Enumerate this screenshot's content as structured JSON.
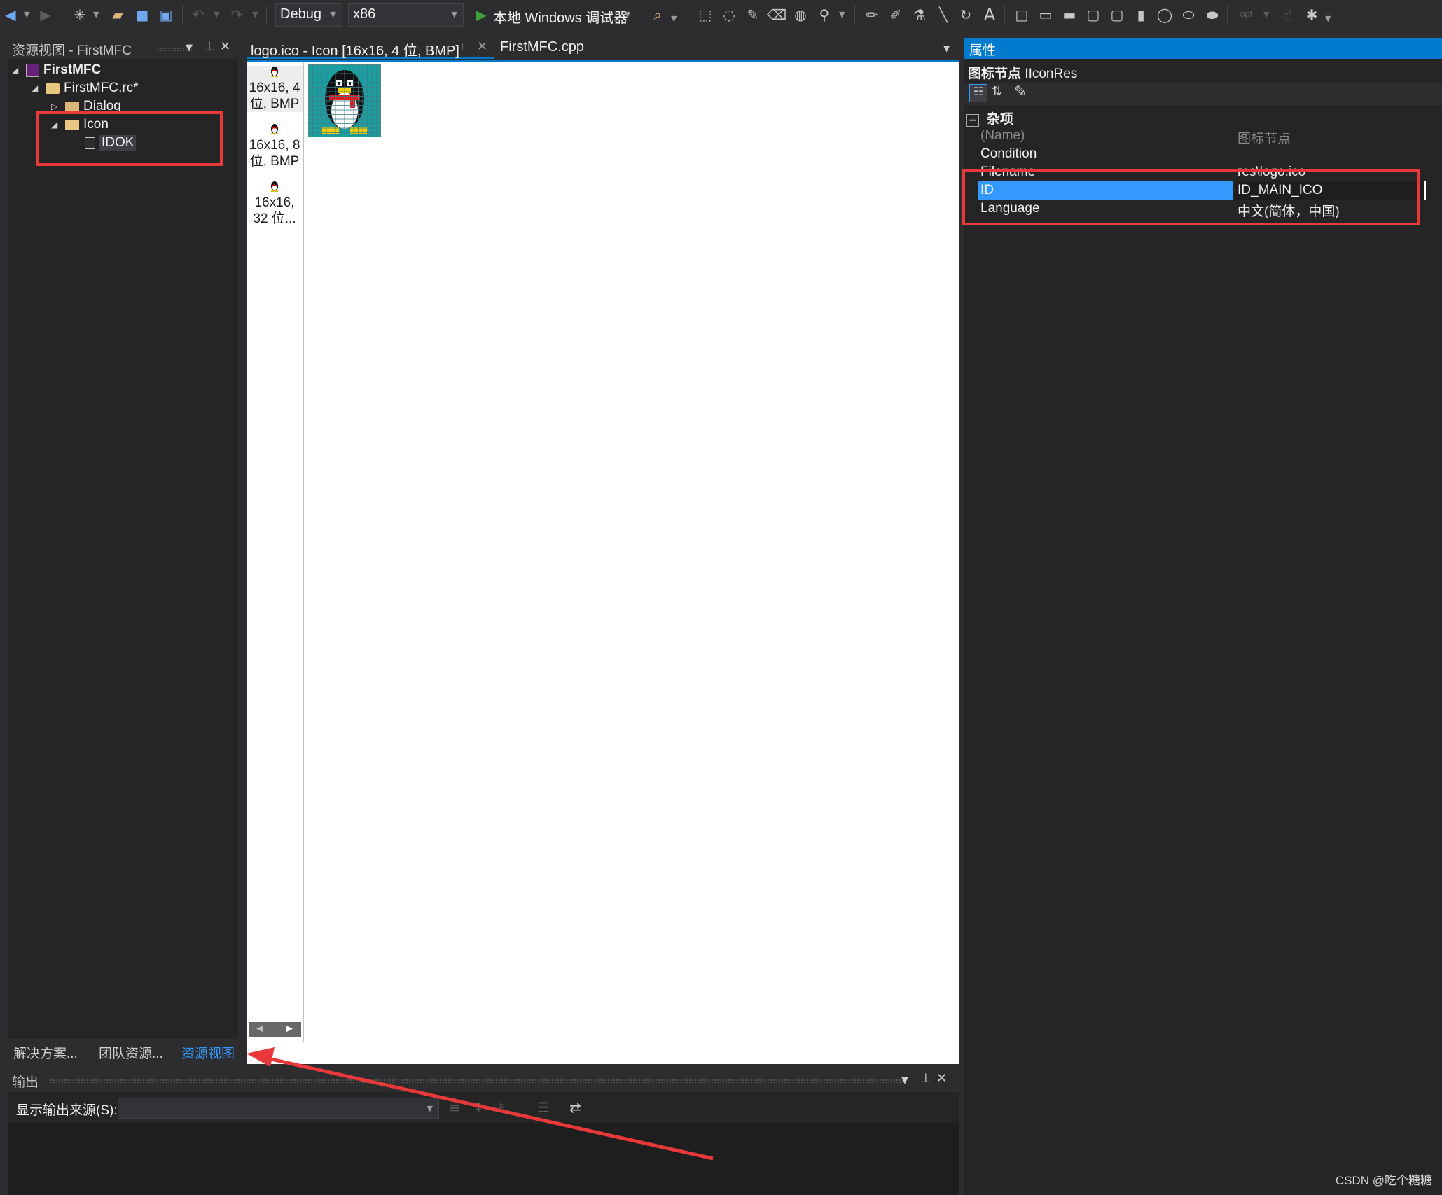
{
  "toolbar": {
    "config": "Debug",
    "platform": "x86",
    "debugger_label": "本地 Windows 调试器",
    "opt_label": "opt"
  },
  "resource_view": {
    "title": "资源视图 - FirstMFC",
    "tree": [
      {
        "label": "FirstMFC",
        "expanded": true
      },
      {
        "label": "FirstMFC.rc*",
        "expanded": true
      },
      {
        "label": "Dialog",
        "expanded": false
      },
      {
        "label": "Icon",
        "expanded": true
      },
      {
        "label": "IDOK",
        "selected": true
      }
    ],
    "bottom_tabs": [
      "解决方案...",
      "团队资源...",
      "资源视图"
    ],
    "active_tab": "资源视图"
  },
  "editor": {
    "tabs": [
      {
        "label": "logo.ico - Icon [16x16, 4 位, BMP]",
        "active": true
      },
      {
        "label": "FirstMFC.cpp",
        "active": false
      }
    ],
    "thumbnails": [
      {
        "line1": "16x16, 4",
        "line2": "位, BMP"
      },
      {
        "line1": "16x16, 8",
        "line2": "位, BMP"
      },
      {
        "line1": "16x16,",
        "line2": "32 位..."
      }
    ]
  },
  "output": {
    "title": "输出",
    "source_label": "显示输出来源(S):",
    "source_value": ""
  },
  "properties": {
    "title": "属性",
    "object": "图标节点",
    "object_type": "IIconRes",
    "category": "杂项",
    "rows": [
      {
        "key": "(Name)",
        "value": "图标节点",
        "dim": true
      },
      {
        "key": "Condition",
        "value": ""
      },
      {
        "key": "Filename",
        "value": "res\\logo.ico"
      },
      {
        "key": "ID",
        "value": "ID_MAIN_ICO",
        "selected": true
      },
      {
        "key": "Language",
        "value": "中文(简体，中国)"
      }
    ]
  },
  "watermark": "CSDN @吃个糖糖",
  "colors": {
    "accent": "#007acc",
    "selection": "#3399ff",
    "annotation": "#e8383a",
    "background": "#2d2d30",
    "panel": "#252526"
  }
}
